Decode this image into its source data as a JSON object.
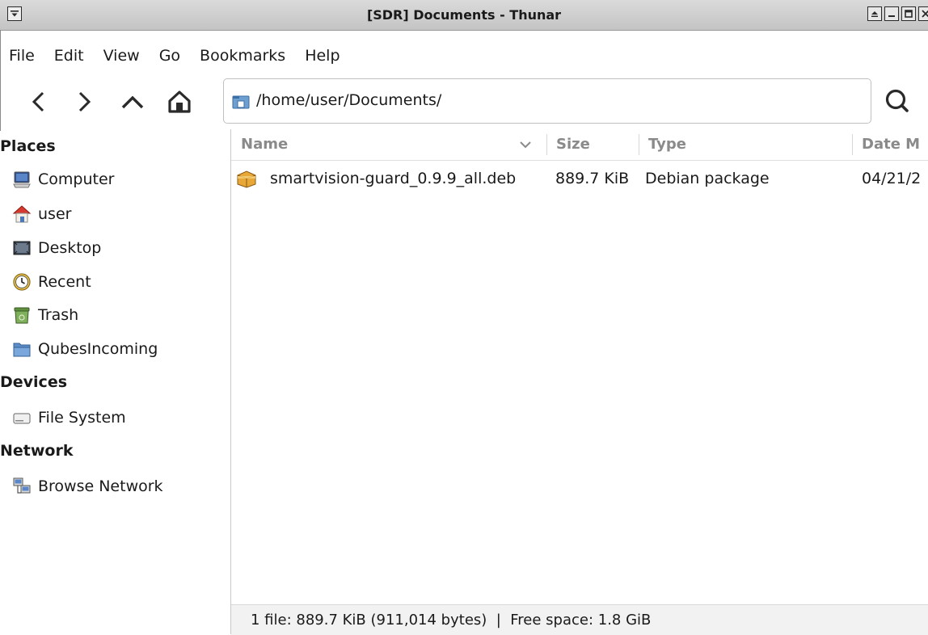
{
  "window": {
    "title": "[SDR] Documents - Thunar"
  },
  "menu": [
    "File",
    "Edit",
    "View",
    "Go",
    "Bookmarks",
    "Help"
  ],
  "location": {
    "path": "/home/user/Documents/"
  },
  "sidebar": {
    "sections": [
      {
        "heading": "Places",
        "items": [
          {
            "label": "Computer",
            "icon": "computer-icon"
          },
          {
            "label": "user",
            "icon": "home-icon"
          },
          {
            "label": "Desktop",
            "icon": "desktop-icon"
          },
          {
            "label": "Recent",
            "icon": "recent-icon"
          },
          {
            "label": "Trash",
            "icon": "trash-icon"
          },
          {
            "label": "QubesIncoming",
            "icon": "folder-icon"
          }
        ]
      },
      {
        "heading": "Devices",
        "items": [
          {
            "label": "File System",
            "icon": "drive-icon"
          }
        ]
      },
      {
        "heading": "Network",
        "items": [
          {
            "label": "Browse Network",
            "icon": "network-icon"
          }
        ]
      }
    ]
  },
  "columns": {
    "name": "Name",
    "size": "Size",
    "type": "Type",
    "date": "Date M"
  },
  "files": [
    {
      "name": "smartvision-guard_0.9.9_all.deb",
      "size": "889.7 KiB",
      "type": "Debian package",
      "date": "04/21/2",
      "icon": "package-icon"
    }
  ],
  "status": {
    "text": "1 file: 889.7 KiB (911,014 bytes)  |  Free space: 1.8 GiB"
  }
}
